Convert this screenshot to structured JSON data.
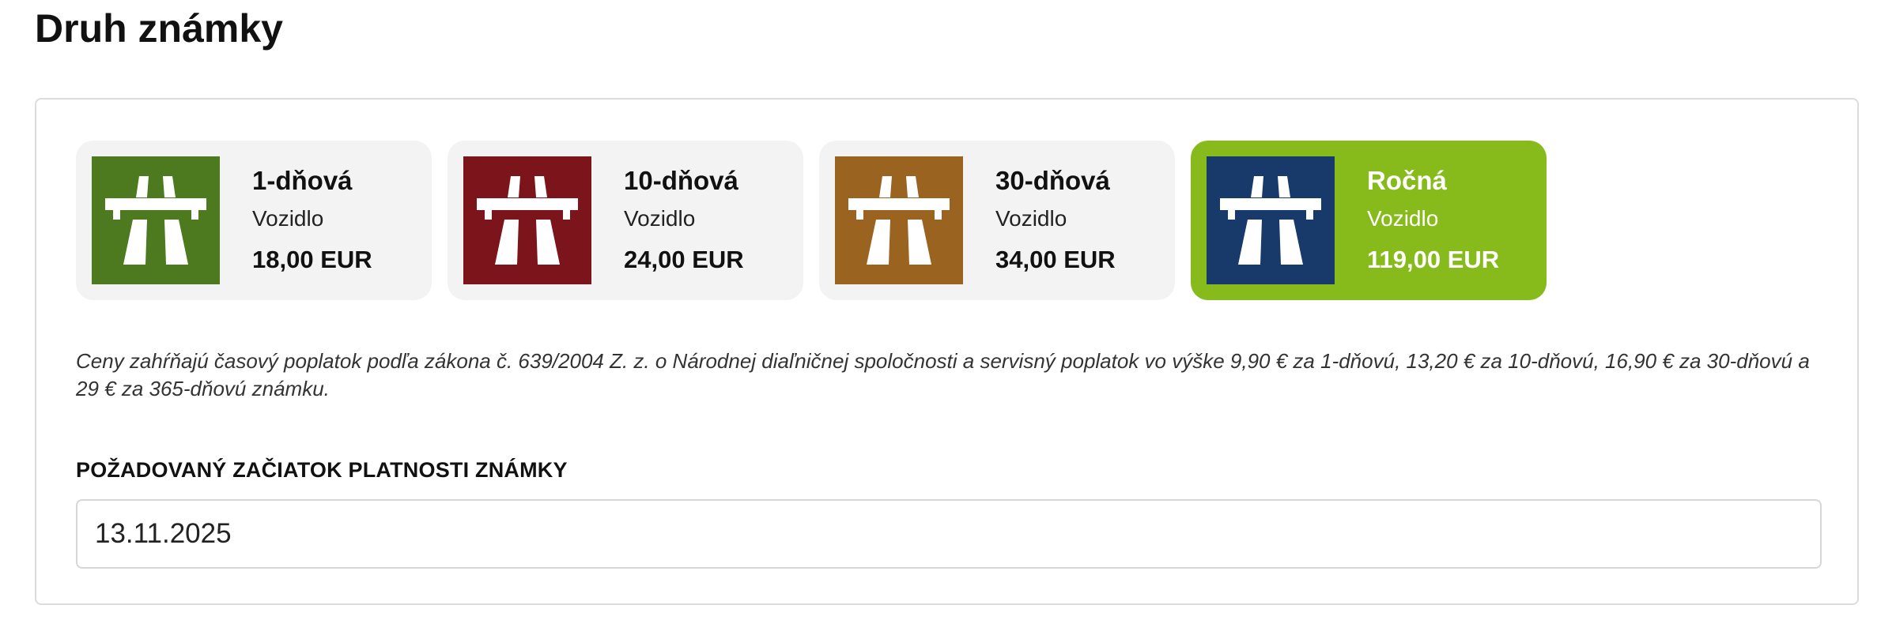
{
  "page": {
    "title": "Druh známky"
  },
  "vignettes": [
    {
      "title": "1-dňová",
      "subtitle": "Vozidlo",
      "price": "18,00 EUR",
      "color": "#4e7a1f",
      "icon": "motorway-icon",
      "selected": false
    },
    {
      "title": "10-dňová",
      "subtitle": "Vozidlo",
      "price": "24,00 EUR",
      "color": "#7b141b",
      "icon": "motorway-icon",
      "selected": false
    },
    {
      "title": "30-dňová",
      "subtitle": "Vozidlo",
      "price": "34,00 EUR",
      "color": "#9a6420",
      "icon": "motorway-icon",
      "selected": false
    },
    {
      "title": "Ročná",
      "subtitle": "Vozidlo",
      "price": "119,00 EUR",
      "color": "#173a6a",
      "icon": "motorway-icon",
      "selected": true
    }
  ],
  "colors": {
    "selected_tile": "#86bb1b",
    "tile_background": "#f3f3f3"
  },
  "note": "Ceny zahŕňajú časový poplatok podľa zákona č. 639/2004 Z. z. o Národnej diaľničnej spoločnosti a servisný poplatok vo výške 9,90 € za 1-dňovú, 13,20 € za 10-dňovú, 16,90 € za 30-dňovú a 29 € za 365-dňovú známku.",
  "start_date": {
    "label": "POŽADOVANÝ ZAČIATOK PLATNOSTI ZNÁMKY",
    "value": "13.11.2025"
  }
}
